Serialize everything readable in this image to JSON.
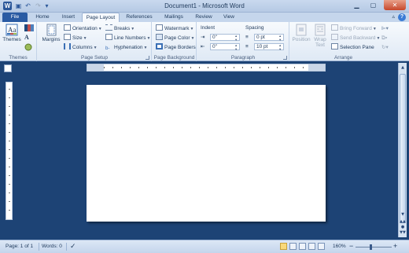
{
  "window": {
    "title": "Document1 - Microsoft Word"
  },
  "tabs": [
    "File",
    "Home",
    "Insert",
    "Page Layout",
    "References",
    "Mailings",
    "Review",
    "View"
  ],
  "active_tab": "Page Layout",
  "ribbon": {
    "themes": {
      "themes_label": "Themes",
      "group_label": "Themes"
    },
    "page_setup": {
      "margins_label": "Margins",
      "orientation_label": "Orientation",
      "size_label": "Size",
      "columns_label": "Columns",
      "breaks_label": "Breaks",
      "line_numbers_label": "Line Numbers",
      "hyphenation_label": "Hyphenation",
      "group_label": "Page Setup"
    },
    "page_background": {
      "watermark_label": "Watermark",
      "page_color_label": "Page Color",
      "page_borders_label": "Page Borders",
      "group_label": "Page Background"
    },
    "paragraph": {
      "indent_label": "Indent",
      "indent_left_value": "0\"",
      "indent_right_value": "0\"",
      "spacing_label": "Spacing",
      "spacing_before_value": "0 pt",
      "spacing_after_value": "10 pt",
      "group_label": "Paragraph"
    },
    "arrange": {
      "position_label": "Position",
      "wrap_text_label": "Wrap Text",
      "bring_forward_label": "Bring Forward",
      "send_backward_label": "Send Backward",
      "selection_pane_label": "Selection Pane",
      "group_label": "Arrange"
    }
  },
  "status": {
    "page": "Page: 1 of 1",
    "words": "Words: 0",
    "zoom": "160%",
    "zoom_minus": "−",
    "zoom_plus": "+"
  },
  "colors": {
    "file_tab": "#2a5ba3",
    "doc_background": "#1d4375",
    "status_bar": "#c4d5ec"
  }
}
